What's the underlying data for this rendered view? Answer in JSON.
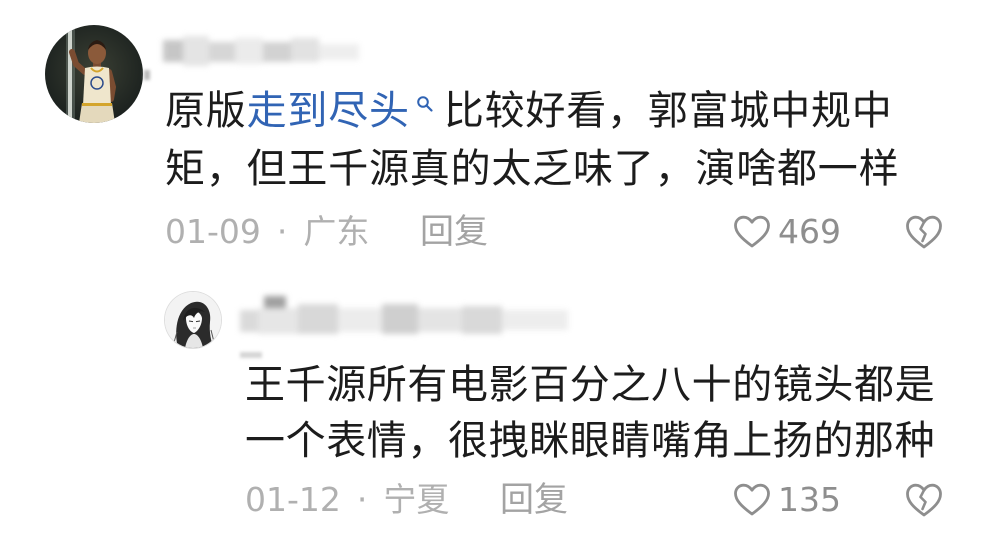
{
  "colors": {
    "text": "#1c1c1c",
    "link": "#3164b4",
    "meta": "#b0b0b0",
    "reply": "#a3a3a3",
    "count": "#8e8e8e",
    "icon": "#8e8e8e",
    "background": "#ffffff"
  },
  "comment": {
    "text": {
      "before_link": "原版",
      "link": "走到尽头",
      "link_icon": "search-icon",
      "after_link": "比较好看，郭富城中规中矩，但王千源真的太乏味了，演啥都一样"
    },
    "meta": {
      "date": "01-09",
      "separator": "·",
      "location": "广东",
      "reply_label": "回复",
      "like_icon": "heart-outline-icon",
      "like_count": "469",
      "dislike_icon": "broken-heart-icon"
    }
  },
  "reply": {
    "text": "王千源所有电影百分之八十的镜头都是一个表情，很拽眯眼睛嘴角上扬的那种",
    "meta": {
      "date": "01-12",
      "separator": "·",
      "location": "宁夏",
      "reply_label": "回复",
      "like_icon": "heart-outline-icon",
      "like_count": "135",
      "dislike_icon": "broken-heart-icon"
    }
  }
}
